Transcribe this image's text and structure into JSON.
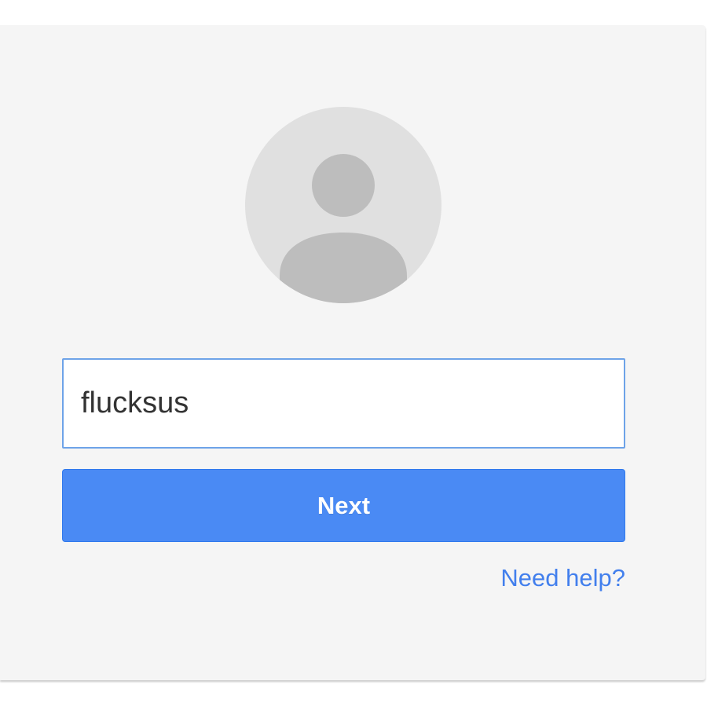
{
  "signin": {
    "username_value": "flucksus",
    "next_label": "Next",
    "help_label": "Need help?"
  },
  "avatar": {
    "icon": "default-user-avatar-icon"
  },
  "colors": {
    "card_background": "#f5f5f5",
    "avatar_background": "#e0e0e0",
    "avatar_figure": "#bdbdbd",
    "input_border_focus": "#6ea3e8",
    "button_primary": "#4a8af4",
    "link": "#427fed"
  }
}
